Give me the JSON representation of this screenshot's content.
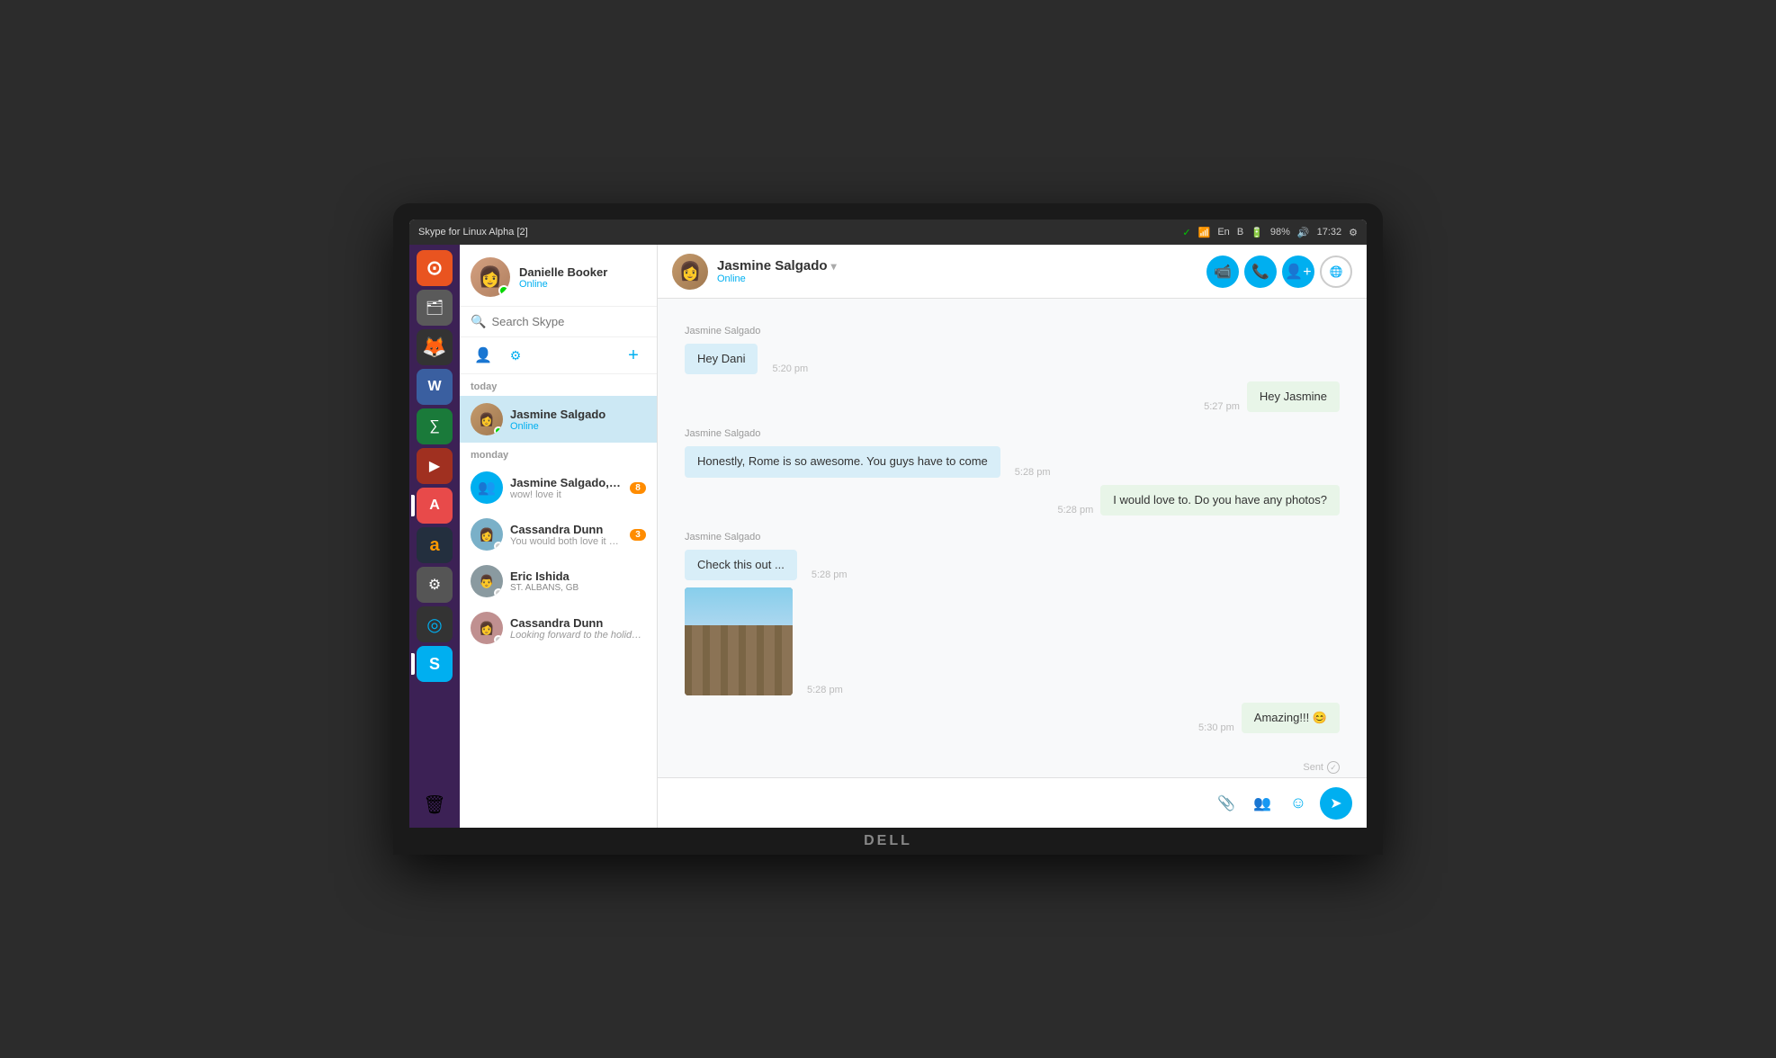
{
  "system_bar": {
    "title": "Skype for Linux Alpha [2]",
    "battery": "98%",
    "time": "17:32",
    "lang": "En"
  },
  "profile": {
    "name": "Danielle Booker",
    "status": "Online"
  },
  "search": {
    "placeholder": "Search Skype"
  },
  "toolbar": {
    "add_label": "+"
  },
  "chat_sections": {
    "today_label": "today",
    "monday_label": "Monday"
  },
  "contacts": [
    {
      "name": "Jasmine Salgado",
      "status": "Online",
      "preview": "Online",
      "active": true,
      "online": true,
      "badge": null
    },
    {
      "name": "Jasmine Salgado, Cassan...",
      "status": null,
      "preview": "wow! love it",
      "active": false,
      "online": false,
      "badge": "8",
      "group": true
    },
    {
      "name": "Cassandra Dunn",
      "status": null,
      "preview": "You would both love it here - we're havin...",
      "active": false,
      "online": false,
      "badge": "3"
    },
    {
      "name": "Eric Ishida",
      "status": "ST. ALBANS, GB",
      "preview": "ST. ALBANS, GB",
      "active": false,
      "online": false,
      "badge": null
    },
    {
      "name": "Cassandra Dunn",
      "status": null,
      "preview": "Looking forward to the holidays",
      "active": false,
      "online": false,
      "badge": null
    }
  ],
  "chat_header": {
    "name": "Jasmine Salgado",
    "status": "Online"
  },
  "messages": [
    {
      "sender": "Jasmine Salgado",
      "text": "Hey Dani",
      "time": "5:20 pm",
      "mine": false
    },
    {
      "sender": null,
      "text": "Hey Jasmine",
      "time": "5:27 pm",
      "mine": true
    },
    {
      "sender": "Jasmine Salgado",
      "text": "Honestly, Rome is so awesome. You guys have to come",
      "time": "5:28 pm",
      "mine": false
    },
    {
      "sender": null,
      "text": "I would love to. Do you have any photos?",
      "time": "5:28 pm",
      "mine": true
    },
    {
      "sender": "Jasmine Salgado",
      "text": "Check this out ...",
      "time": "5:28 pm",
      "mine": false,
      "has_photo": true
    },
    {
      "sender": null,
      "text": "Amazing!!! 😊",
      "time": "5:30 pm",
      "mine": true,
      "is_last": true
    }
  ],
  "sent_label": "Sent",
  "input_placeholder": "",
  "ubuntu_icons": [
    {
      "name": "ubuntu-logo",
      "icon": "⊙",
      "color": "#e95420"
    },
    {
      "name": "files",
      "icon": "📁",
      "color": "#5a5a5a"
    },
    {
      "name": "firefox",
      "icon": "🦊",
      "color": "transparent"
    },
    {
      "name": "writer",
      "icon": "W",
      "color": "#3a5fa0"
    },
    {
      "name": "calc",
      "icon": "∑",
      "color": "#1a7a3a"
    },
    {
      "name": "impress",
      "icon": "▶",
      "color": "#a03020"
    },
    {
      "name": "appstore",
      "icon": "A",
      "color": "#e84a4a"
    },
    {
      "name": "amazon",
      "icon": "a",
      "color": "#ff9900"
    },
    {
      "name": "settings",
      "icon": "⚙",
      "color": "#666"
    },
    {
      "name": "chrome",
      "icon": "◎",
      "color": "transparent"
    },
    {
      "name": "skype",
      "icon": "S",
      "color": "#00aff0"
    },
    {
      "name": "trash",
      "icon": "🗑",
      "color": "transparent"
    }
  ],
  "dell_logo": "DELL"
}
